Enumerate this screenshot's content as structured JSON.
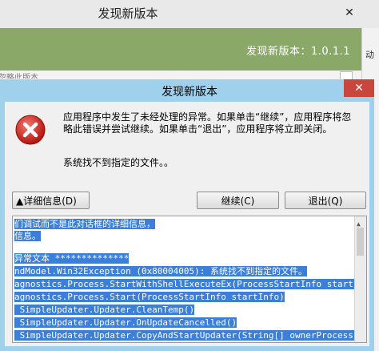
{
  "background_window": {
    "title": "发现新版本",
    "close": "✕",
    "version_text": "发现新版本：1.0.1.1",
    "right_strip_text": "动",
    "under_text": "忽略此版本"
  },
  "dialog": {
    "title": "发现新版本",
    "close": "✕",
    "message": "应用程序中发生了未经处理的异常。如果单击“继续”，应用程序将忽略此错误并尝试继续。如果单击“退出”，应用程序将立即关闭。",
    "error_text": "系统找不到指定的文件。。",
    "buttons": {
      "details": "▲详细信息(D)",
      "continue": "继续(C)",
      "quit": "退出(Q)"
    },
    "details_lines": [
      "们调试而不是此对话框的详细信息，",
      "信息。",
      "",
      "异常文本 **************",
      "ndModel.Win32Exception (0x80004005): 系统找不到指定的文件。",
      "agnostics.Process.StartWithShellExecuteEx(ProcessStartInfo startIn",
      "agnostics.Process.Start(ProcessStartInfo startInfo)",
      " SimpleUpdater.Updater.CleanTemp()",
      " SimpleUpdater.Updater.OnUpdateCancelled()",
      " SimpleUpdater.Updater.CopyAndStartUpdater(String[] ownerProcessLi"
    ]
  },
  "colors": {
    "header_green": "#8aa868",
    "dialog_frame": "#9fd0ec",
    "close_red": "#c9463d",
    "selection_blue": "#3b7fd9"
  }
}
